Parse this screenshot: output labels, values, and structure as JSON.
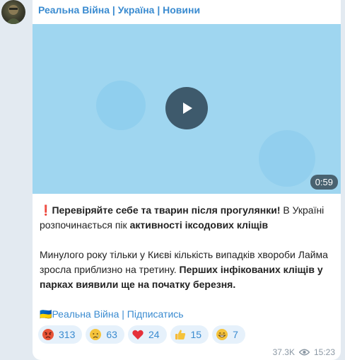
{
  "channel": {
    "title": "Реальна Війна | Україна | Новини"
  },
  "video": {
    "duration": "0:59"
  },
  "post": {
    "line1_icon": "❗",
    "line1_bold": "Перевіряйте себе та тварин після прогулянки!",
    "line1_rest": " В Україні розпочинається пік ",
    "line1_bold2": "активності іксодових кліщів",
    "line2_rest": "Минулого року тільки у Києві кількість випадків хвороби Лайма зросла приблизно на третину. ",
    "line2_bold": "Перших інфікованих кліщів у парках виявили ще на початку березня.",
    "footer_flag": "🇺🇦",
    "footer_link": "Реальна Війна | Підписатись"
  },
  "reactions": [
    {
      "icon": "angry-face-icon",
      "count": "313"
    },
    {
      "icon": "crying-face-icon",
      "count": "63"
    },
    {
      "icon": "red-heart-icon",
      "count": "24"
    },
    {
      "icon": "thumbs-up-icon",
      "count": "15"
    },
    {
      "icon": "grinning-face-icon",
      "count": "7"
    }
  ],
  "meta": {
    "views": "37.3K",
    "time": "15:23"
  },
  "colors": {
    "accent": "#3a8bd0",
    "bubble": "#ffffff",
    "background": "#e3eaf1",
    "video_bg": "#9fd6f0"
  }
}
